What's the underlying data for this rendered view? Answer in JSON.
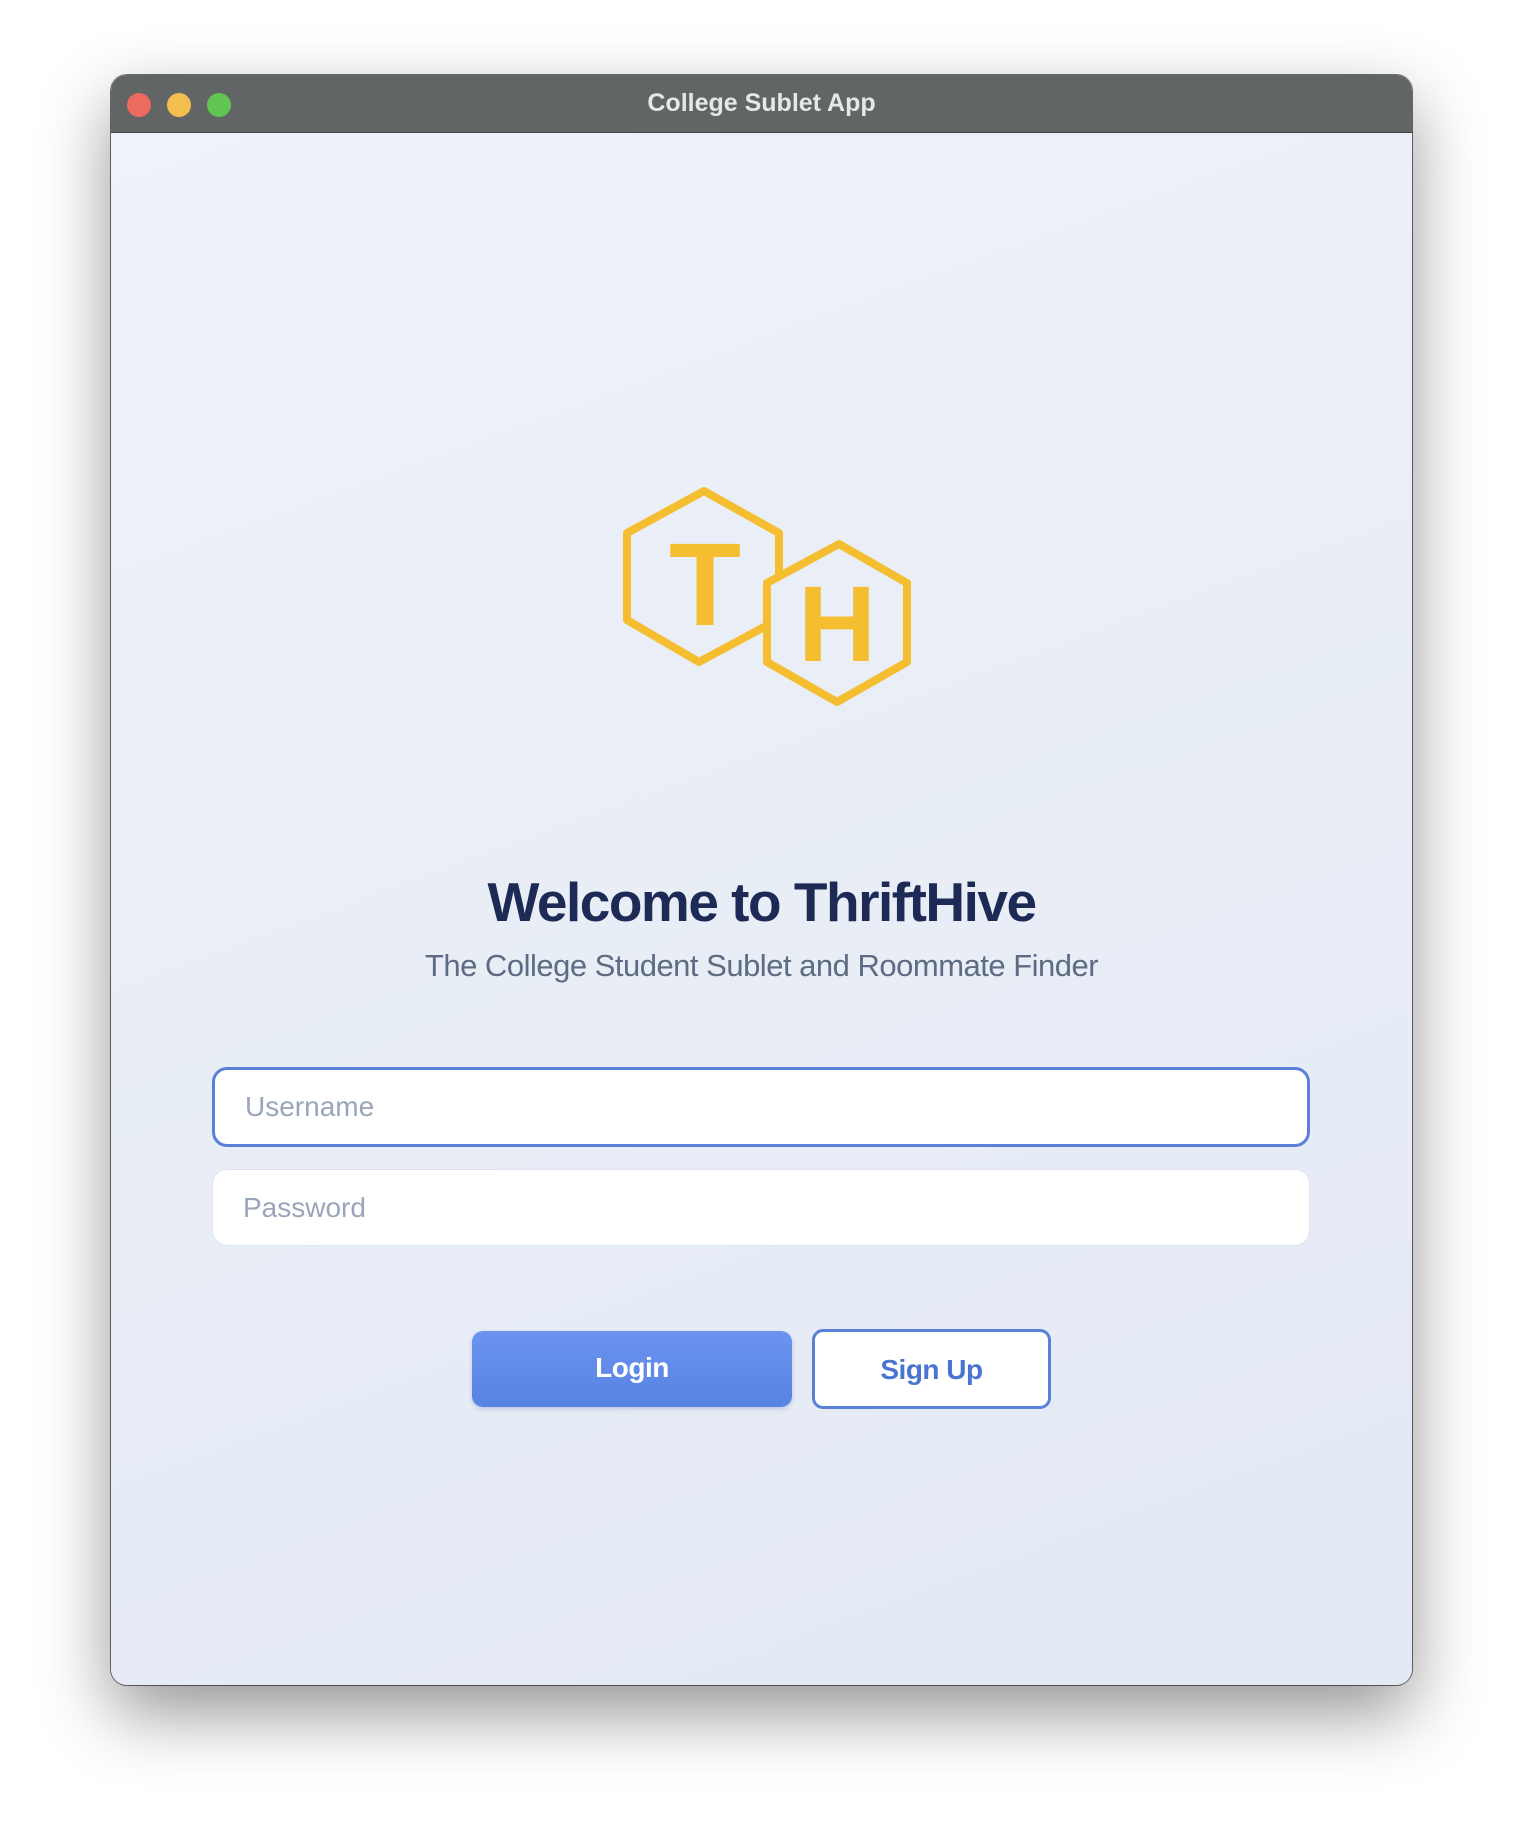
{
  "window": {
    "title": "College Sublet App"
  },
  "logo": {
    "letters": [
      "T",
      "H"
    ],
    "color": "#f5bd30"
  },
  "welcome": {
    "heading": "Welcome to ThriftHive",
    "subheading": "The College Student Sublet and Roommate Finder"
  },
  "form": {
    "username": {
      "placeholder": "Username",
      "value": ""
    },
    "password": {
      "placeholder": "Password",
      "value": ""
    }
  },
  "buttons": {
    "login": "Login",
    "signup": "Sign Up"
  },
  "colors": {
    "accent": "#5a80d8",
    "heading": "#1c2a55",
    "titlebar": "#626566"
  }
}
